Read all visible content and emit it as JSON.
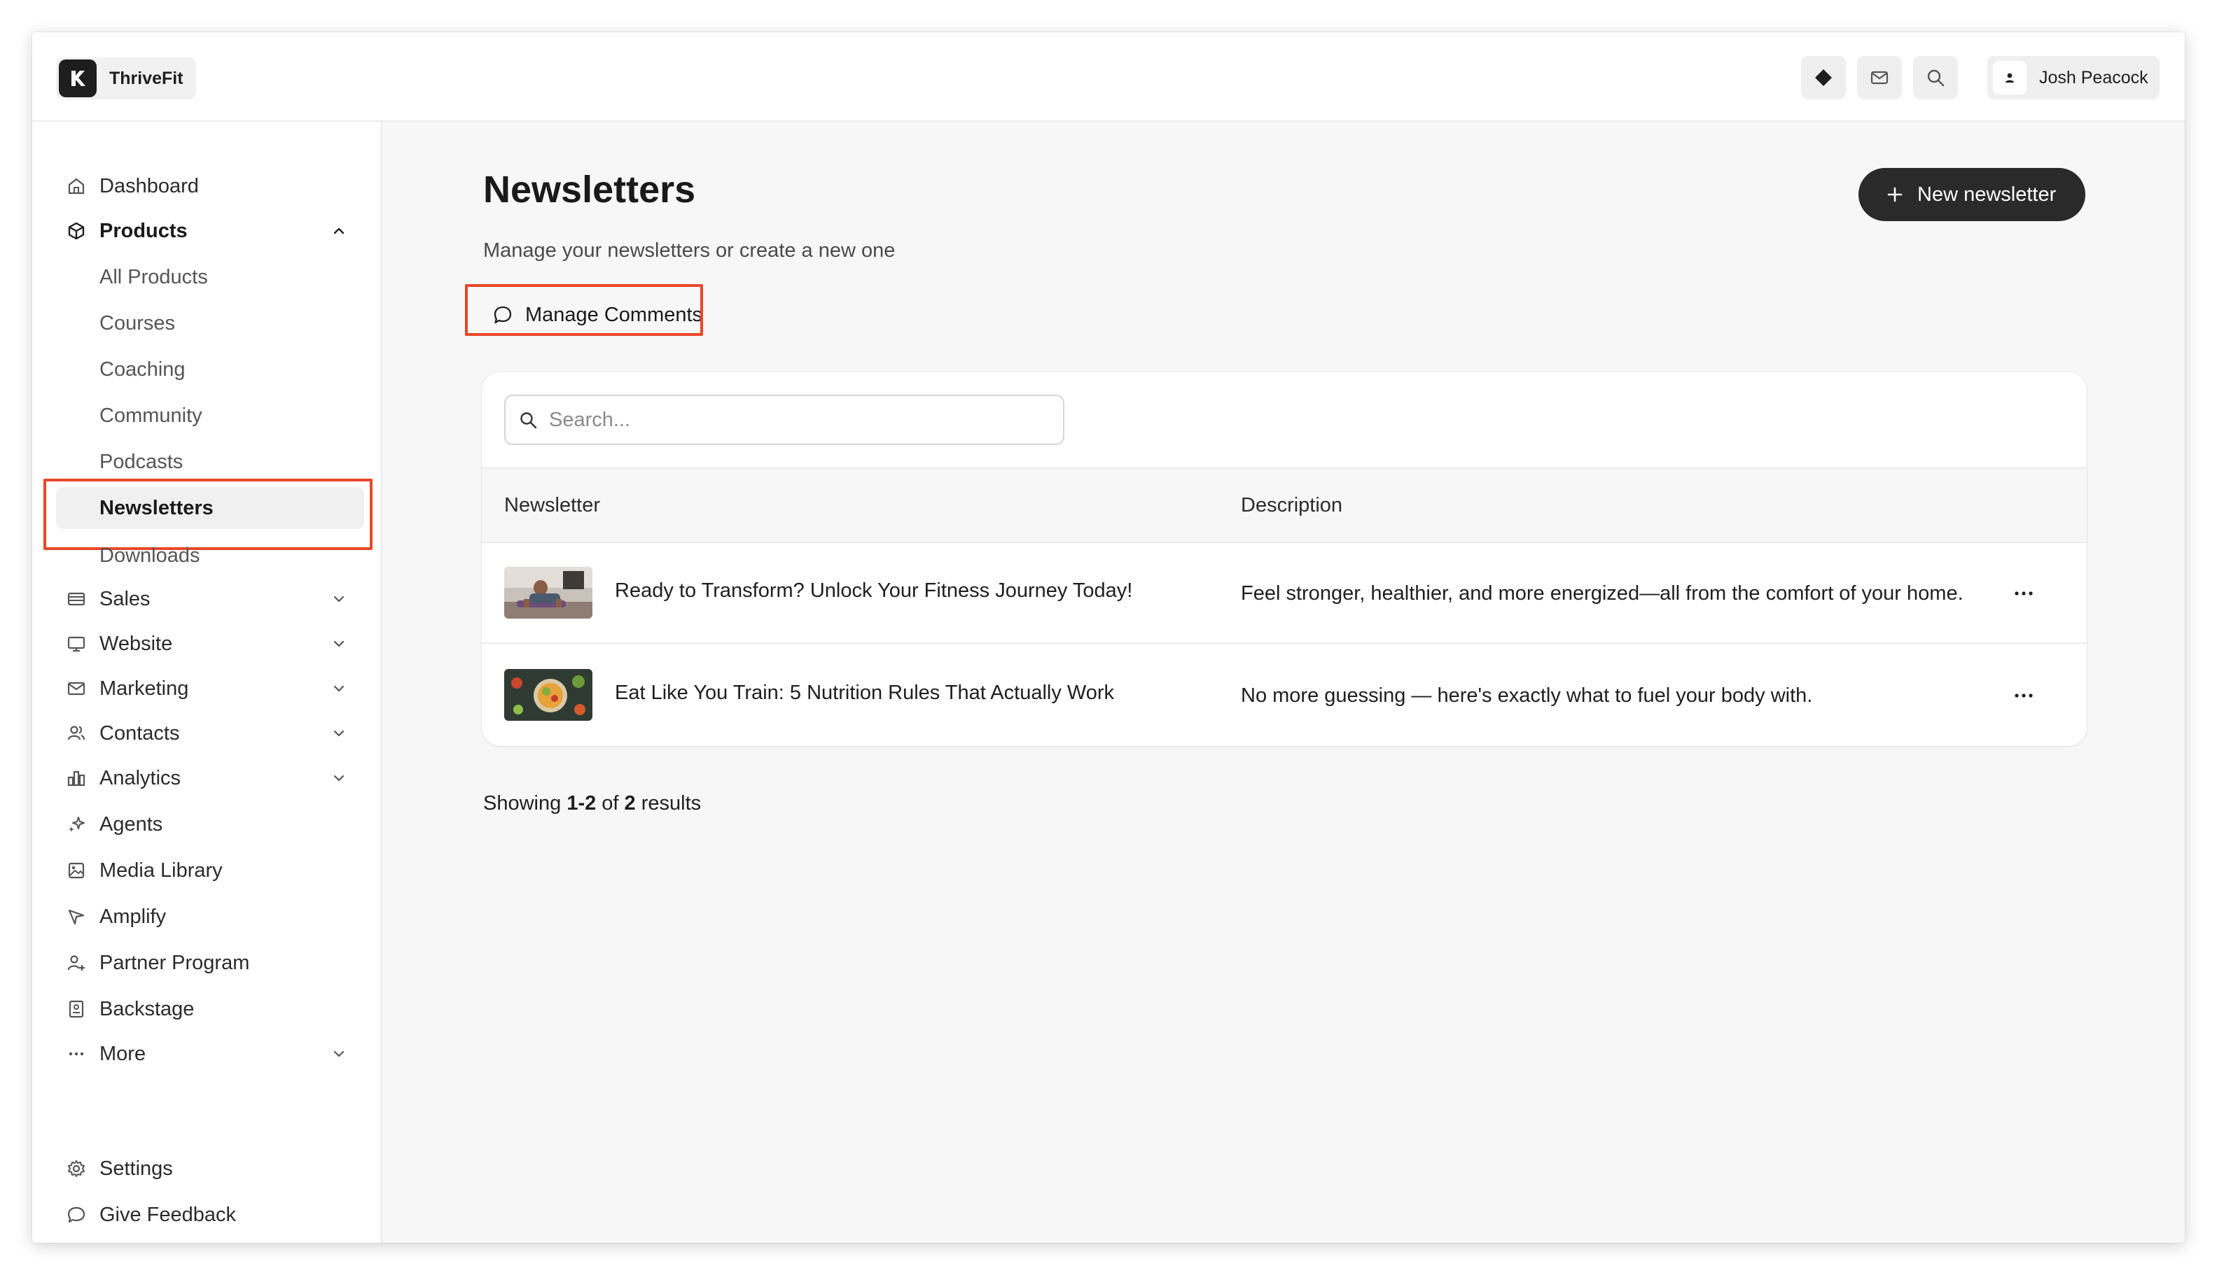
{
  "app": {
    "name": "ThriveFit"
  },
  "topbar": {
    "user_name": "Josh Peacock"
  },
  "sidebar": {
    "items": [
      {
        "label": "Dashboard",
        "icon": "home-icon"
      },
      {
        "label": "Products",
        "icon": "box-icon",
        "expanded": true
      },
      {
        "label": "Sales",
        "icon": "card-icon"
      },
      {
        "label": "Website",
        "icon": "monitor-icon"
      },
      {
        "label": "Marketing",
        "icon": "mail-icon"
      },
      {
        "label": "Contacts",
        "icon": "users-icon"
      },
      {
        "label": "Analytics",
        "icon": "bar-chart-icon"
      },
      {
        "label": "Agents",
        "icon": "sparkles-icon"
      },
      {
        "label": "Media Library",
        "icon": "image-icon"
      },
      {
        "label": "Amplify",
        "icon": "send-icon"
      },
      {
        "label": "Partner Program",
        "icon": "user-plus-icon"
      },
      {
        "label": "Backstage",
        "icon": "backstage-icon"
      },
      {
        "label": "More",
        "icon": "more-dots-icon"
      }
    ],
    "product_subitems": [
      {
        "label": "All Products"
      },
      {
        "label": "Courses"
      },
      {
        "label": "Coaching"
      },
      {
        "label": "Community"
      },
      {
        "label": "Podcasts"
      },
      {
        "label": "Newsletters",
        "active": true
      },
      {
        "label": "Downloads"
      }
    ],
    "footer": [
      {
        "label": "Settings",
        "icon": "gear-icon"
      },
      {
        "label": "Give Feedback",
        "icon": "chat-bubble-icon"
      }
    ]
  },
  "main": {
    "title": "Newsletters",
    "subtitle": "Manage your newsletters or create a new one",
    "new_button_label": "New newsletter",
    "manage_comments_label": "Manage Comments",
    "search_placeholder": "Search...",
    "columns": [
      "Newsletter",
      "Description"
    ],
    "rows": [
      {
        "title": "Ready to Transform? Unlock Your Fitness Journey Today!",
        "description": "Feel stronger, healthier, and more energized—all from the comfort of your home."
      },
      {
        "title": "Eat Like You Train: 5 Nutrition Rules That Actually Work",
        "description": "No more guessing — here's exactly what to fuel your body with."
      }
    ],
    "results": {
      "prefix": "Showing",
      "range": "1-2",
      "of": "of",
      "total": "2",
      "suffix": "results"
    }
  },
  "colors": {
    "accent_dark": "#2a2a2a",
    "highlight": "#e8472b",
    "background": "#f7f7f7"
  }
}
